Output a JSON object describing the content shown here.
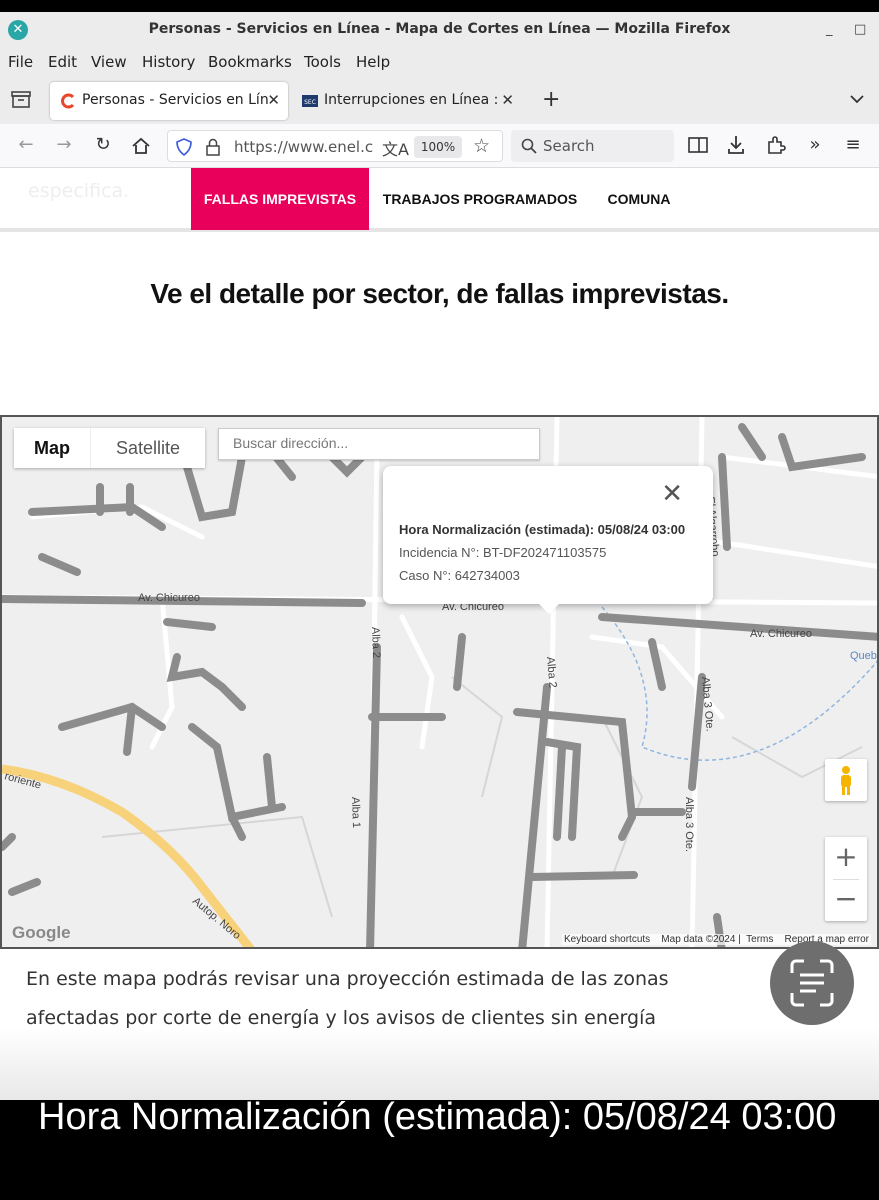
{
  "window": {
    "title": "Personas - Servicios en Línea - Mapa de Cortes en Línea — Mozilla Firefox",
    "minimize": "_",
    "maximize": "□"
  },
  "menu": [
    "File",
    "Edit",
    "View",
    "History",
    "Bookmarks",
    "Tools",
    "Help"
  ],
  "tabs": [
    {
      "label": "Personas - Servicios en Lín",
      "active": true
    },
    {
      "label": "Interrupciones en Línea :",
      "active": false
    }
  ],
  "navbar": {
    "url": "https://www.enel.c",
    "zoom": "100%",
    "search_placeholder": "Search"
  },
  "site": {
    "ghost_text": "especifica.",
    "nav": [
      "FALLAS IMPREVISTAS",
      "TRABAJOS PROGRAMADOS",
      "COMUNA"
    ],
    "headline": "Ve el detalle por sector, de fallas imprevistas.",
    "description": "En este mapa podrás revisar una proyección estimada de las zonas afectadas por corte de energía y los avisos de clientes sin energía"
  },
  "map": {
    "type_buttons": [
      "Map",
      "Satellite"
    ],
    "address_placeholder": "Buscar dirección...",
    "popup": {
      "line1": "Hora Normalización (estimada): 05/08/24 03:00",
      "line2": "Incidencia N°: BT-DF202471103575",
      "line3": "Caso N°: 642734003"
    },
    "streets": [
      "Av. Chicureo",
      "Av. Chicureo",
      "Av. Chicureo",
      "Alba 2",
      "Alba 1",
      "Alba 3 Ote.",
      "Alba 3 Ote.",
      "El Algarrobo",
      "Autop. Noro",
      "roriente",
      "Quebr"
    ],
    "footer": [
      "Keyboard shortcuts",
      "Map data ©2024",
      "Terms",
      "Report a map error"
    ],
    "logo": "Google"
  },
  "caption": "Hora Normalización (estimada): 05/08/24 03:00",
  "colors": {
    "accent": "#e8005a",
    "outage": "#8c8c8c",
    "highway": "#f7d27a"
  }
}
